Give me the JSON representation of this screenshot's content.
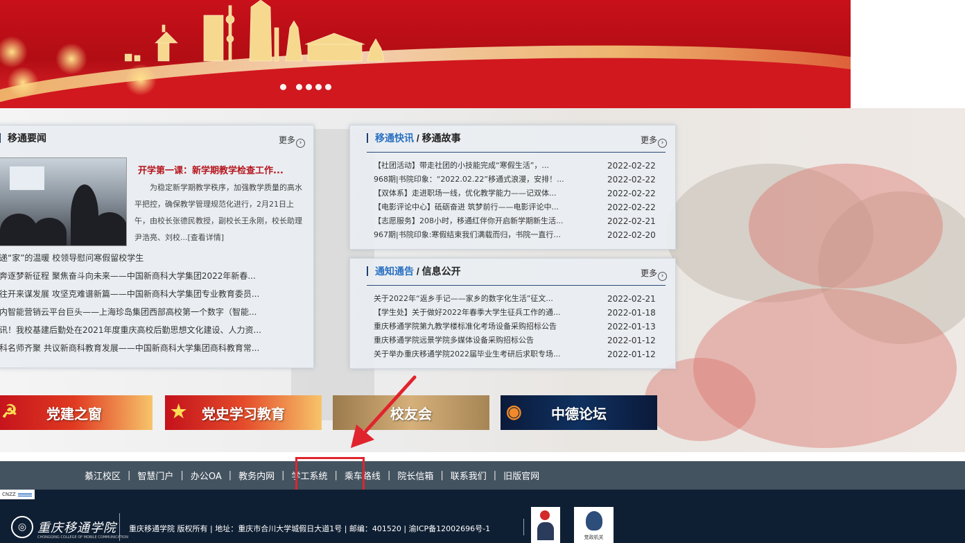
{
  "banner": {
    "slide_count": 5,
    "active_slide": 1
  },
  "news": {
    "title": "移通要闻",
    "more": "更多",
    "featured": {
      "title": "开学第一课：新学期教学检查工作...",
      "body": "为稳定新学期教学秩序，加强教学质量的高水平把控，确保教学管理规范化进行，2月21日上午，由校长张德民教授，副校长王永刚，校长助理尹浩亮、刘校...[查看详情]"
    },
    "items": [
      "递“家”的温暖 校领导慰问寒假留校学生",
      "奔逐梦新征程 聚焦奋斗向未来——中国新商科大学集团2022年新春...",
      "往开来谋发展 攻坚克难谱新篇——中国新商科大学集团专业教育委员...",
      "内智能营销云平台巨头——上海珍岛集团西部高校第一个数字（智能...",
      "讯！我校基建后勤处在2021年度重庆高校后勤思想文化建设、人力资...",
      "科名师齐聚 共议新商科教育发展——中国新商科大学集团商科教育常..."
    ]
  },
  "flash": {
    "title_a": "移通快讯",
    "title_sep": " / ",
    "title_b": "移通故事",
    "more": "更多",
    "items": [
      {
        "text": "【社团活动】带走社团的小技能完成“寒假生活”，...",
        "date": "2022-02-22"
      },
      {
        "text": "968期|书院印象：“2022.02.22”移通式浪漫，安排！...",
        "date": "2022-02-22"
      },
      {
        "text": "【双体系】走进职场一线，优化教学能力——记双体...",
        "date": "2022-02-22"
      },
      {
        "text": "【电影评论中心】砥砺奋进 筑梦前行——电影评论中...",
        "date": "2022-02-22"
      },
      {
        "text": "【志愿服务】208小时，移通红伴你开启新学期新生活...",
        "date": "2022-02-21"
      },
      {
        "text": "967期|书院印象:寒假结束我们满载而归，书院一直行...",
        "date": "2022-02-20"
      }
    ]
  },
  "notice": {
    "title_a": "通知通告",
    "title_sep": " / ",
    "title_b": "信息公开",
    "more": "更多",
    "items": [
      {
        "text": "关于2022年“返乡手记——家乡的数字化生活”征文...",
        "date": "2022-02-21"
      },
      {
        "text": "【学生处】关于做好2022年春季大学生征兵工作的通...",
        "date": "2022-01-18"
      },
      {
        "text": "重庆移通学院第九教学楼标准化考场设备采购招标公告",
        "date": "2022-01-13"
      },
      {
        "text": "重庆移通学院远景学院多媒体设备采购招标公告",
        "date": "2022-01-12"
      },
      {
        "text": "关于举办重庆移通学院2022届毕业生考研后求职专场...",
        "date": "2022-01-12"
      }
    ]
  },
  "links": {
    "party": "党建之窗",
    "history": "党史学习教育",
    "alumni": "校友会",
    "forum": "中德论坛"
  },
  "nav": {
    "separator": "|",
    "items": [
      "綦江校区",
      "智慧门户",
      "办公OA",
      "教务内网",
      "学工系统",
      "乘车路线",
      "院长信箱",
      "联系我们",
      "旧版官网"
    ]
  },
  "footer": {
    "school_name": "重庆移通学院",
    "school_en": "CHONGQING COLLEGE OF MOBILE COMMUNICATION",
    "copyright": "重庆移通学院 版权所有 | 地址：重庆市合川大学城假日大道1号 | 邮编：401520 | 渝ICP备12002696号-1",
    "badge2_caption": "党政机关",
    "badge3_text": "CNZZ"
  },
  "colors": {
    "banner_red": "#c8101a",
    "nav_bg": "#445360",
    "footer_bg": "#0f1f33",
    "highlight": "#e0242d",
    "accent_blue": "#2a6fc1",
    "featured_red": "#b5151c"
  }
}
